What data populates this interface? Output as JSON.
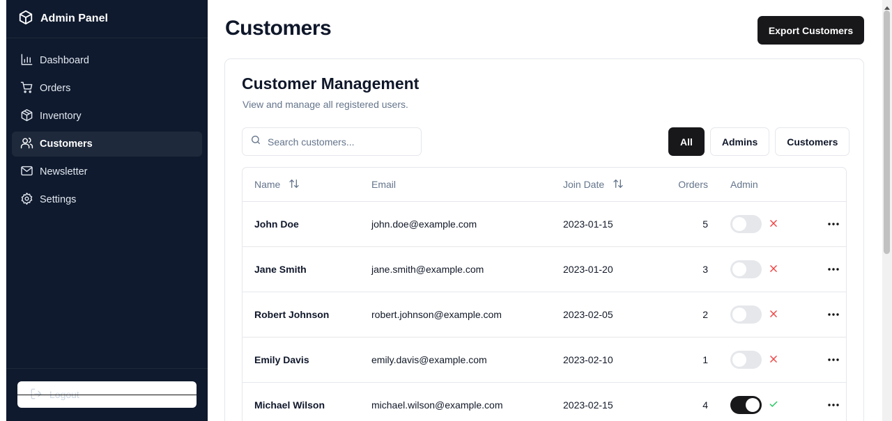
{
  "brand": {
    "name": "Admin Panel"
  },
  "nav": [
    {
      "label": "Dashboard",
      "icon": "bar-chart-icon",
      "active": false
    },
    {
      "label": "Orders",
      "icon": "cart-icon",
      "active": false
    },
    {
      "label": "Inventory",
      "icon": "package-icon",
      "active": false
    },
    {
      "label": "Customers",
      "icon": "users-icon",
      "active": true
    },
    {
      "label": "Newsletter",
      "icon": "mail-icon",
      "active": false
    },
    {
      "label": "Settings",
      "icon": "gear-icon",
      "active": false
    }
  ],
  "logout": {
    "label": "Logout"
  },
  "page": {
    "title": "Customers",
    "export_label": "Export Customers"
  },
  "card": {
    "title": "Customer Management",
    "subtitle": "View and manage all registered users."
  },
  "search": {
    "placeholder": "Search customers..."
  },
  "filters": [
    {
      "label": "All",
      "active": true
    },
    {
      "label": "Admins",
      "active": false
    },
    {
      "label": "Customers",
      "active": false
    }
  ],
  "table": {
    "headers": {
      "name": "Name",
      "email": "Email",
      "join_date": "Join Date",
      "orders": "Orders",
      "admin": "Admin"
    },
    "rows": [
      {
        "name": "John Doe",
        "email": "john.doe@example.com",
        "join_date": "2023-01-15",
        "orders": "5",
        "admin": false
      },
      {
        "name": "Jane Smith",
        "email": "jane.smith@example.com",
        "join_date": "2023-01-20",
        "orders": "3",
        "admin": false
      },
      {
        "name": "Robert Johnson",
        "email": "robert.johnson@example.com",
        "join_date": "2023-02-05",
        "orders": "2",
        "admin": false
      },
      {
        "name": "Emily Davis",
        "email": "emily.davis@example.com",
        "join_date": "2023-02-10",
        "orders": "1",
        "admin": false
      },
      {
        "name": "Michael Wilson",
        "email": "michael.wilson@example.com",
        "join_date": "2023-02-15",
        "orders": "4",
        "admin": true
      }
    ]
  },
  "colors": {
    "sidebar": "#0f1a2e",
    "primary": "#18181b",
    "false_mark": "#ef4444",
    "true_mark": "#22c55e"
  }
}
